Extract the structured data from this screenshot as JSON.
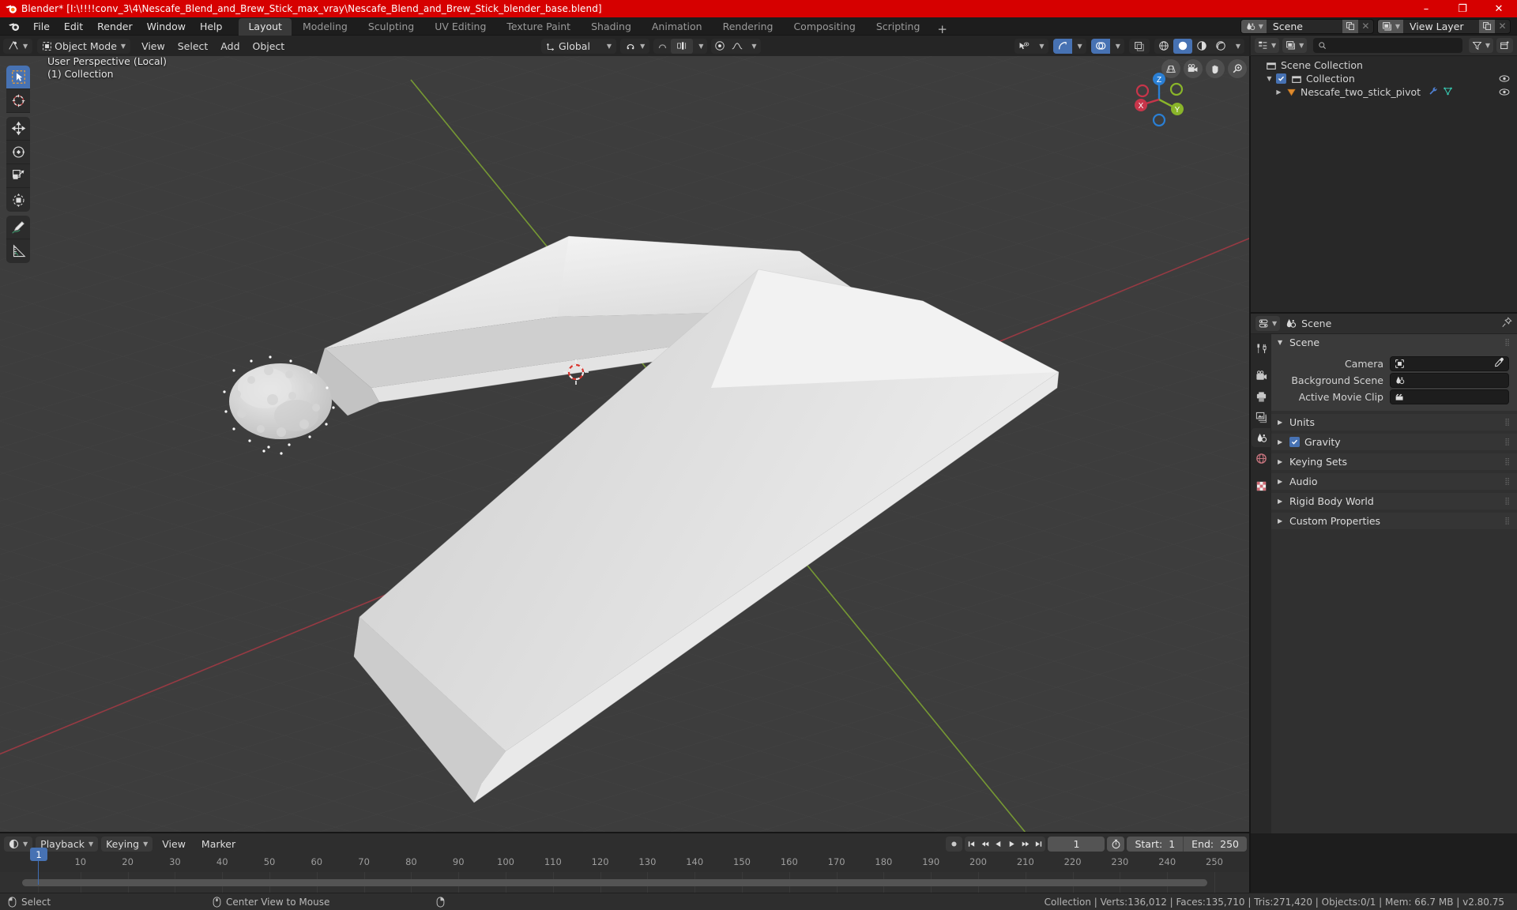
{
  "window": {
    "title": "Blender* [I:\\!!!!conv_3\\4\\Nescafe_Blend_and_Brew_Stick_max_vray\\Nescafe_Blend_and_Brew_Stick_blender_base.blend]",
    "minimize": "–",
    "maximize": "❐",
    "close": "✕"
  },
  "topbar": {
    "menus": [
      "File",
      "Edit",
      "Render",
      "Window",
      "Help"
    ],
    "workspaces": [
      {
        "label": "Layout",
        "active": true
      },
      {
        "label": "Modeling",
        "active": false
      },
      {
        "label": "Sculpting",
        "active": false
      },
      {
        "label": "UV Editing",
        "active": false
      },
      {
        "label": "Texture Paint",
        "active": false
      },
      {
        "label": "Shading",
        "active": false
      },
      {
        "label": "Animation",
        "active": false
      },
      {
        "label": "Rendering",
        "active": false
      },
      {
        "label": "Compositing",
        "active": false
      },
      {
        "label": "Scripting",
        "active": false
      }
    ],
    "add_workspace": "+",
    "scene_name": "Scene",
    "view_layer_name": "View Layer"
  },
  "viewport": {
    "mode": "Object Mode",
    "menus": [
      "View",
      "Select",
      "Add",
      "Object"
    ],
    "transform_orientation": "Global",
    "overlay_line1": "User Perspective (Local)",
    "overlay_line2": "(1) Collection",
    "gizmo_axes": {
      "x": "X",
      "y": "Y",
      "z": "Z"
    }
  },
  "outliner": {
    "display_mode": "View Layer",
    "search_placeholder": "",
    "rows": [
      {
        "label": "Scene Collection",
        "indent": 0,
        "icon": "collection-icon",
        "disclosure": "",
        "checkbox": false,
        "eye": false
      },
      {
        "label": "Collection",
        "indent": 1,
        "icon": "collection-icon",
        "disclosure": "▼",
        "checkbox": true,
        "eye": true
      },
      {
        "label": "Nescafe_two_stick_pivot",
        "indent": 2,
        "icon": "empty-icon",
        "disclosure": "▶",
        "checkbox": false,
        "eye": true
      }
    ]
  },
  "properties": {
    "breadcrumb": "Scene",
    "panels": [
      {
        "label": "Scene",
        "open": true,
        "checkbox": null
      },
      {
        "label": "Units",
        "open": false,
        "checkbox": null
      },
      {
        "label": "Gravity",
        "open": false,
        "checkbox": true
      },
      {
        "label": "Keying Sets",
        "open": false,
        "checkbox": null
      },
      {
        "label": "Audio",
        "open": false,
        "checkbox": null
      },
      {
        "label": "Rigid Body World",
        "open": false,
        "checkbox": null
      },
      {
        "label": "Custom Properties",
        "open": false,
        "checkbox": null
      }
    ],
    "fields": [
      {
        "label": "Camera",
        "value": "",
        "icon": "camera-data-icon",
        "eyedropper": true
      },
      {
        "label": "Background Scene",
        "value": "",
        "icon": "scene-icon",
        "eyedropper": false
      },
      {
        "label": "Active Movie Clip",
        "value": "",
        "icon": "clip-icon",
        "eyedropper": false
      }
    ]
  },
  "timeline": {
    "menus": [
      "Playback",
      "Keying",
      "View",
      "Marker"
    ],
    "current_frame": "1",
    "start_label": "Start:",
    "start_value": "1",
    "end_label": "End:",
    "end_value": "250",
    "ticks": [
      "1",
      "10",
      "20",
      "30",
      "40",
      "50",
      "60",
      "70",
      "80",
      "90",
      "100",
      "110",
      "120",
      "130",
      "140",
      "150",
      "160",
      "170",
      "180",
      "190",
      "200",
      "210",
      "220",
      "230",
      "240",
      "250"
    ]
  },
  "statusbar": {
    "left": [
      {
        "icon": "mouse-left-icon",
        "label": "Select"
      },
      {
        "icon": "mouse-middle-icon",
        "label": "Center View to Mouse"
      },
      {
        "icon": "mouse-right-icon",
        "label": ""
      }
    ],
    "stats": "Collection | Verts:136,012 | Faces:135,710 | Tris:271,420 | Objects:0/1 | Mem: 66.7 MB | v2.80.75"
  },
  "colors": {
    "title_bar": "#d60000",
    "accent_blue": "#4772b3",
    "viewport_bg": "#3d3d3d",
    "axis_x": "#c7354a",
    "axis_y": "#8ab52a",
    "axis_z": "#2a7fd4"
  }
}
